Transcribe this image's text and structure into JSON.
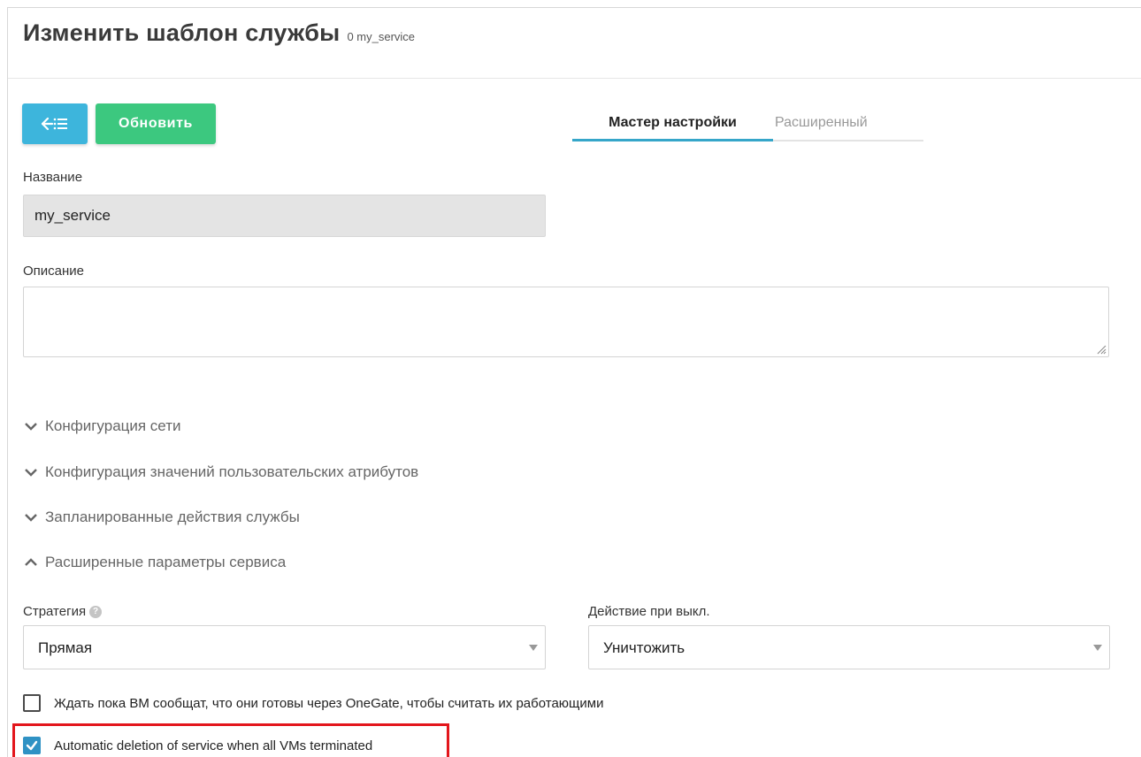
{
  "header": {
    "title": "Изменить шаблон службы",
    "subtitle": "0 my_service"
  },
  "toolbar": {
    "back_icon": "back-to-list-icon",
    "update_label": "Обновить"
  },
  "tabs": {
    "wizard_label": "Мастер настройки",
    "advanced_label": "Расширенный"
  },
  "form": {
    "name_label": "Название",
    "name_value": "my_service",
    "description_label": "Описание",
    "description_value": ""
  },
  "sections": [
    {
      "label": "Конфигурация сети",
      "state": "collapsed"
    },
    {
      "label": "Конфигурация значений пользовательских атрибутов",
      "state": "collapsed"
    },
    {
      "label": "Запланированные действия службы",
      "state": "collapsed"
    },
    {
      "label": "Расширенные параметры сервиса",
      "state": "expanded"
    }
  ],
  "advanced": {
    "strategy_label": "Стратегия",
    "strategy_value": "Прямая",
    "shutdown_label": "Действие при выкл.",
    "shutdown_value": "Уничтожить",
    "wait_ready_label": "Ждать пока ВМ сообщат, что они готовы через OneGate, чтобы считать их работающими",
    "wait_ready_checked": false,
    "auto_delete_label": "Automatic deletion of service when all VMs terminated",
    "auto_delete_checked": true
  },
  "colors": {
    "back_button": "#3db5dc",
    "update_button": "#3cc87f",
    "active_tab_underline": "#35a6c9",
    "checkbox_checked": "#2f92c4",
    "highlight": "#e3161c"
  }
}
